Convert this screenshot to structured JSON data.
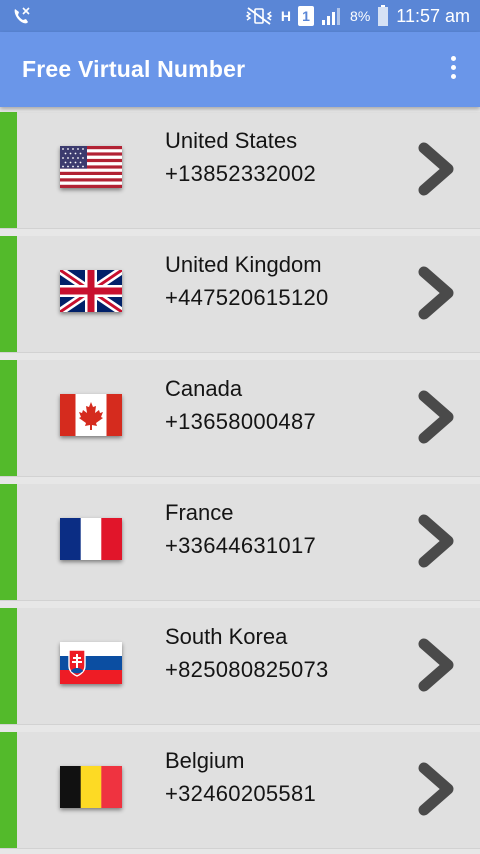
{
  "status_bar": {
    "battery_percent": "8%",
    "time": "11:57 am",
    "sim_slot": "1",
    "network_type": "H",
    "icons": [
      "missed-call-icon",
      "mute-vibrate-icon",
      "network-type-icon",
      "sim-slot-icon",
      "signal-icon",
      "battery-icon"
    ]
  },
  "app_bar": {
    "title": "Free Virtual Number",
    "menu_icon": "overflow-menu-icon"
  },
  "colors": {
    "status_bar": "#5a86d6",
    "app_bar": "#6a96e9",
    "accent": "#53ba2b",
    "row_bg": "#e0e0e0",
    "chevron": "#4a4a4a"
  },
  "numbers": [
    {
      "country": "United States",
      "phone": "+13852332002",
      "flag": "us-flag-icon"
    },
    {
      "country": "United Kingdom",
      "phone": "+447520615120",
      "flag": "uk-flag-icon"
    },
    {
      "country": "Canada",
      "phone": "+13658000487",
      "flag": "canada-flag-icon"
    },
    {
      "country": "France",
      "phone": "+33644631017",
      "flag": "france-flag-icon"
    },
    {
      "country": "South Korea",
      "phone": "+825080825073",
      "flag": "slovakia-flag-icon"
    },
    {
      "country": "Belgium",
      "phone": "+32460205581",
      "flag": "belgium-flag-icon"
    }
  ]
}
